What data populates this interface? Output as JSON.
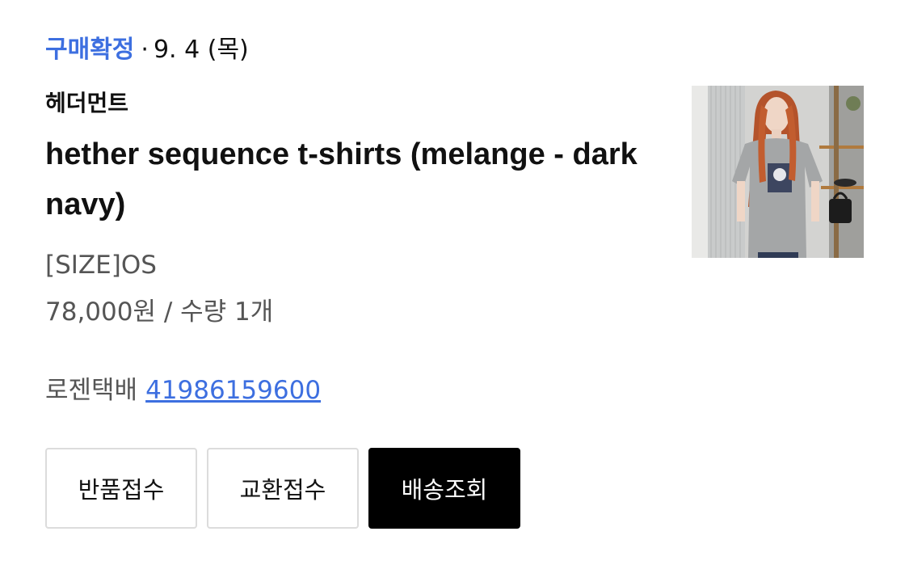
{
  "order": {
    "status_label": "구매확정",
    "separator": "·",
    "date": "9. 4 (목)"
  },
  "product": {
    "brand": "헤더먼트",
    "name": "hether sequence t-shirts (melange - dark navy)",
    "option": "[SIZE]OS",
    "price_quantity": "78,000원 / 수량 1개",
    "image_alt": "hether sequence t-shirts model photo"
  },
  "shipping": {
    "carrier": "로젠택배",
    "tracking_number": "41986159600"
  },
  "actions": {
    "return_label": "반품접수",
    "exchange_label": "교환접수",
    "track_label": "배송조회"
  },
  "colors": {
    "accent": "#3d6fe0",
    "primary_button": "#000000",
    "secondary_text": "#555555",
    "border": "#dcdcdc"
  }
}
